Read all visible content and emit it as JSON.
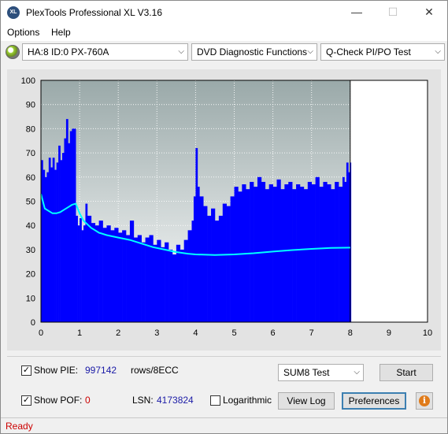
{
  "window": {
    "title": "PlexTools Professional XL V3.16",
    "logo_text": "XL",
    "minimize": "—",
    "maximize": "☐",
    "close": "✕"
  },
  "menu": {
    "items": [
      {
        "label": "Options"
      },
      {
        "label": "Help"
      }
    ]
  },
  "toolbar": {
    "drive": "HA:8 ID:0  PX-760A",
    "function": "DVD Diagnostic Functions",
    "test": "Q-Check PI/PO Test"
  },
  "chart_data": {
    "type": "area",
    "x_ticks": [
      "0",
      "1",
      "2",
      "3",
      "4",
      "5",
      "6",
      "7",
      "8",
      "9",
      "10"
    ],
    "y_ticks": [
      "0",
      "10",
      "20",
      "30",
      "40",
      "50",
      "60",
      "70",
      "80",
      "90",
      "100"
    ],
    "xlim": [
      0,
      10
    ],
    "ylim": [
      0,
      100
    ],
    "scanned_until_x": 8.0,
    "grid": true,
    "series": [
      {
        "role": "PIE bars",
        "color": "#0000ff",
        "points": [
          [
            0,
            67
          ],
          [
            0.05,
            63
          ],
          [
            0.1,
            60
          ],
          [
            0.15,
            62
          ],
          [
            0.2,
            68
          ],
          [
            0.25,
            64
          ],
          [
            0.3,
            68
          ],
          [
            0.35,
            63
          ],
          [
            0.4,
            66
          ],
          [
            0.45,
            73
          ],
          [
            0.5,
            67
          ],
          [
            0.55,
            70
          ],
          [
            0.6,
            76
          ],
          [
            0.65,
            84
          ],
          [
            0.7,
            74
          ],
          [
            0.75,
            79
          ],
          [
            0.8,
            80
          ],
          [
            0.85,
            80
          ],
          [
            0.9,
            44
          ],
          [
            0.95,
            40
          ],
          [
            1.0,
            43
          ],
          [
            1.05,
            38
          ],
          [
            1.1,
            40
          ],
          [
            1.15,
            49
          ],
          [
            1.2,
            44
          ],
          [
            1.3,
            41
          ],
          [
            1.4,
            40
          ],
          [
            1.5,
            42
          ],
          [
            1.6,
            39
          ],
          [
            1.7,
            40
          ],
          [
            1.8,
            38
          ],
          [
            1.9,
            39
          ],
          [
            2.0,
            37
          ],
          [
            2.1,
            38
          ],
          [
            2.2,
            36
          ],
          [
            2.3,
            42
          ],
          [
            2.4,
            35
          ],
          [
            2.5,
            36
          ],
          [
            2.6,
            33
          ],
          [
            2.7,
            35
          ],
          [
            2.8,
            36
          ],
          [
            2.9,
            32
          ],
          [
            3.0,
            34
          ],
          [
            3.1,
            31
          ],
          [
            3.2,
            33
          ],
          [
            3.3,
            30
          ],
          [
            3.4,
            28
          ],
          [
            3.5,
            32
          ],
          [
            3.6,
            30
          ],
          [
            3.7,
            34
          ],
          [
            3.8,
            38
          ],
          [
            3.9,
            42
          ],
          [
            3.95,
            52
          ],
          [
            4.0,
            72
          ],
          [
            4.05,
            56
          ],
          [
            4.1,
            52
          ],
          [
            4.2,
            48
          ],
          [
            4.3,
            44
          ],
          [
            4.4,
            47
          ],
          [
            4.5,
            42
          ],
          [
            4.6,
            44
          ],
          [
            4.7,
            49
          ],
          [
            4.8,
            48
          ],
          [
            4.9,
            52
          ],
          [
            5.0,
            56
          ],
          [
            5.1,
            54
          ],
          [
            5.2,
            57
          ],
          [
            5.3,
            55
          ],
          [
            5.4,
            58
          ],
          [
            5.5,
            56
          ],
          [
            5.6,
            60
          ],
          [
            5.7,
            58
          ],
          [
            5.8,
            55
          ],
          [
            5.9,
            57
          ],
          [
            6.0,
            56
          ],
          [
            6.1,
            59
          ],
          [
            6.2,
            55
          ],
          [
            6.3,
            57
          ],
          [
            6.4,
            58
          ],
          [
            6.5,
            55
          ],
          [
            6.6,
            57
          ],
          [
            6.7,
            56
          ],
          [
            6.8,
            55
          ],
          [
            6.9,
            58
          ],
          [
            7.0,
            57
          ],
          [
            7.1,
            60
          ],
          [
            7.2,
            56
          ],
          [
            7.3,
            58
          ],
          [
            7.4,
            57
          ],
          [
            7.5,
            55
          ],
          [
            7.6,
            58
          ],
          [
            7.7,
            56
          ],
          [
            7.8,
            60
          ],
          [
            7.85,
            58
          ],
          [
            7.9,
            66
          ],
          [
            7.95,
            62
          ],
          [
            8.0,
            66
          ]
        ]
      },
      {
        "role": "speed line",
        "color": "#00ffff",
        "points": [
          [
            0,
            53
          ],
          [
            0.1,
            47
          ],
          [
            0.2,
            46
          ],
          [
            0.3,
            45
          ],
          [
            0.4,
            45
          ],
          [
            0.5,
            45.5
          ],
          [
            0.6,
            46.5
          ],
          [
            0.7,
            47.5
          ],
          [
            0.8,
            48.5
          ],
          [
            0.9,
            49
          ],
          [
            1.0,
            45
          ],
          [
            1.1,
            42
          ],
          [
            1.2,
            40.5
          ],
          [
            1.3,
            39
          ],
          [
            1.4,
            38
          ],
          [
            1.5,
            37
          ],
          [
            1.7,
            36
          ],
          [
            2.0,
            35
          ],
          [
            2.3,
            34
          ],
          [
            2.6,
            32.5
          ],
          [
            2.9,
            31
          ],
          [
            3.2,
            30
          ],
          [
            3.5,
            29
          ],
          [
            3.8,
            28.3
          ],
          [
            4.0,
            28
          ],
          [
            4.5,
            27.8
          ],
          [
            5.0,
            28
          ],
          [
            5.5,
            28.5
          ],
          [
            6.0,
            29.2
          ],
          [
            6.5,
            29.8
          ],
          [
            7.0,
            30.3
          ],
          [
            7.5,
            30.7
          ],
          [
            8.0,
            30.8
          ]
        ]
      }
    ]
  },
  "controls": {
    "show_pie_label": "Show PIE:",
    "pie_value": "997142",
    "pie_unit": "rows/8ECC",
    "show_pof_label": "Show POF:",
    "pof_value": "0",
    "lsn_label": "LSN:",
    "lsn_value": "4173824",
    "logarithmic_label": "Logarithmic",
    "sum_select": "SUM8 Test",
    "start_button": "Start",
    "viewlog_button": "View Log",
    "preferences_button": "Preferences",
    "info_glyph": "i",
    "check_mark": "✓",
    "combo_arrow": "⌵"
  },
  "status": {
    "text": "Ready"
  }
}
